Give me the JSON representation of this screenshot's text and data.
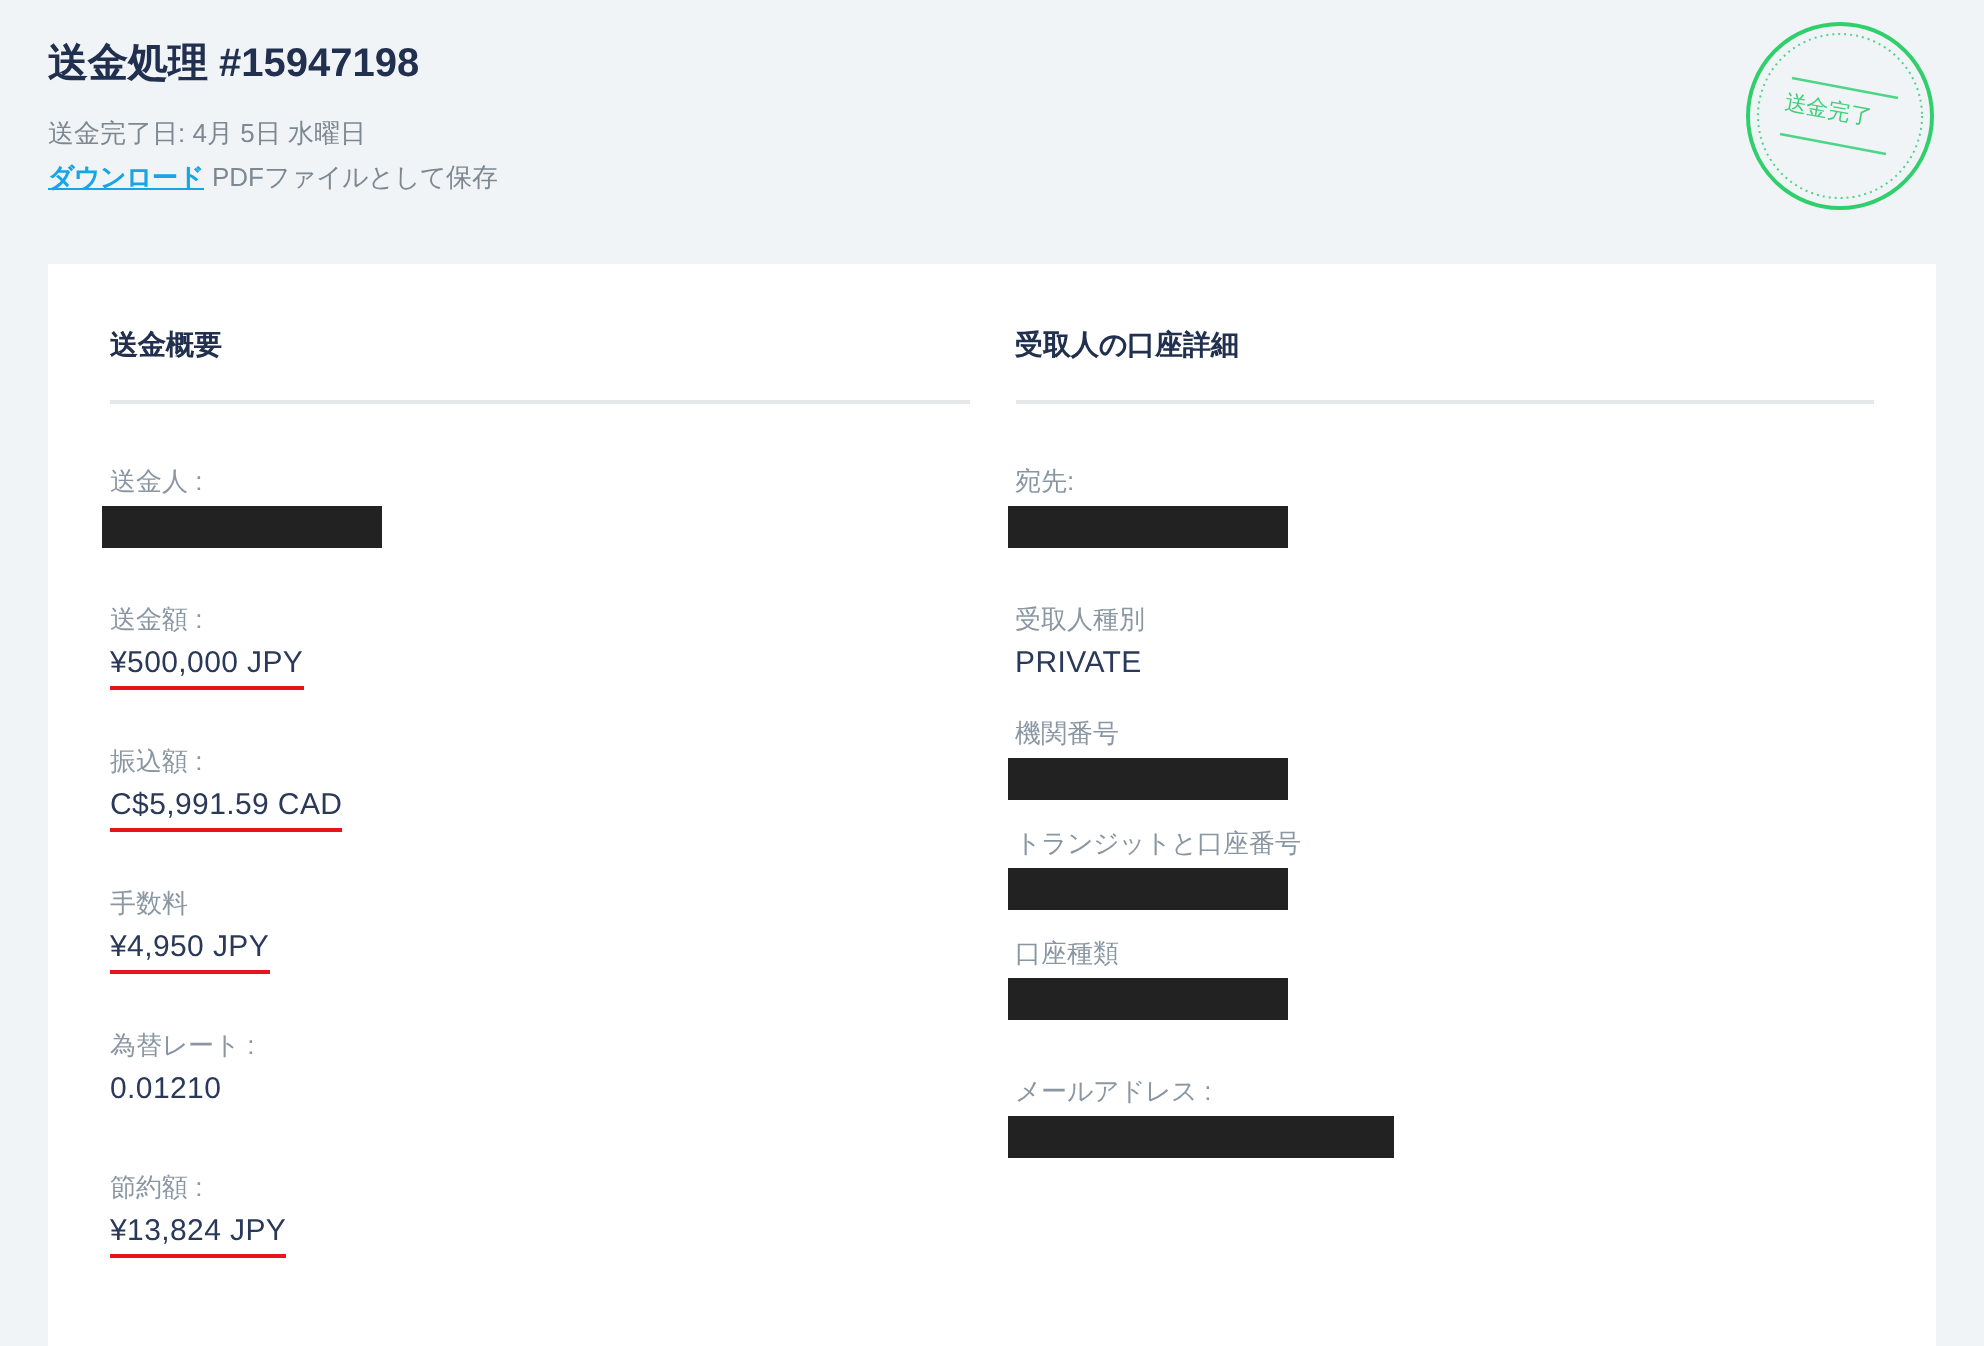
{
  "header": {
    "title": "送金処理 #15947198",
    "completed_date": "送金完了日: 4月 5日 水曜日",
    "download_link": "ダウンロード",
    "download_note": "PDFファイルとして保存",
    "stamp": {
      "text": "送金完了"
    }
  },
  "panels": [
    {
      "heading": "送金概要",
      "groups": [
        {
          "fields": [
            {
              "kind": "redacted",
              "label": "送金人 :"
            }
          ]
        },
        {
          "fields": [
            {
              "kind": "text",
              "label": "送金額 :",
              "value": "¥500,000 JPY",
              "underlined": true
            }
          ]
        },
        {
          "fields": [
            {
              "kind": "text",
              "label": "振込額 :",
              "value": "C$5,991.59 CAD",
              "underlined": true
            }
          ]
        },
        {
          "fields": [
            {
              "kind": "text",
              "label": "手数料",
              "value": "¥4,950 JPY",
              "underlined": true
            }
          ]
        },
        {
          "fields": [
            {
              "kind": "text",
              "label": "為替レート :",
              "value": "0.01210",
              "underlined": false
            }
          ]
        },
        {
          "fields": [
            {
              "kind": "text",
              "label": "節約額 :",
              "value": "¥13,824 JPY",
              "underlined": true
            }
          ]
        }
      ]
    },
    {
      "heading": "受取人の口座詳細",
      "groups": [
        {
          "fields": [
            {
              "kind": "redacted",
              "label": "宛先:"
            }
          ]
        },
        {
          "fields": [
            {
              "kind": "text",
              "label": "受取人種別",
              "value": "PRIVATE",
              "underlined": false
            },
            {
              "kind": "redacted",
              "label": "機関番号"
            },
            {
              "kind": "redacted",
              "label": "トランジットと口座番号"
            },
            {
              "kind": "redacted",
              "label": "口座種類"
            }
          ]
        },
        {
          "fields": [
            {
              "kind": "redacted_wide",
              "label": "メールアドレス :"
            }
          ]
        }
      ]
    }
  ]
}
